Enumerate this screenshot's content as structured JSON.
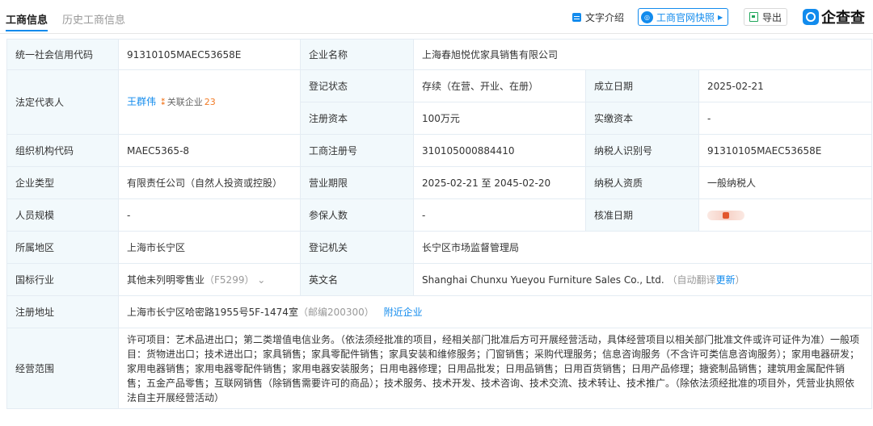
{
  "tabs": [
    {
      "label": "工商信息",
      "active": true
    },
    {
      "label": "历史工商信息",
      "active": false
    }
  ],
  "toolbar": {
    "text_intro_label": "文字介绍",
    "snapshot_label": "工商官网快照",
    "export_label": "导出",
    "logo_text": "企查查"
  },
  "colors": {
    "accent": "#128bed",
    "label_bg": "#f2f9fc",
    "border": "#e4ecf3",
    "badge_orange": "#f27a24"
  },
  "fields": {
    "credit_code": {
      "label": "统一社会信用代码",
      "value": "91310105MAEC53658E"
    },
    "company_name": {
      "label": "企业名称",
      "value": "上海春旭悦优家具销售有限公司"
    },
    "legal_rep": {
      "label": "法定代表人",
      "value": "王群伟",
      "related_label": "关联企业",
      "related_count": "23"
    },
    "reg_status": {
      "label": "登记状态",
      "value": "存续（在营、开业、在册）"
    },
    "established": {
      "label": "成立日期",
      "value": "2025-02-21"
    },
    "reg_capital": {
      "label": "注册资本",
      "value": "100万元"
    },
    "paid_capital": {
      "label": "实缴资本",
      "value": "-"
    },
    "org_code": {
      "label": "组织机构代码",
      "value": "MAEC5365-8"
    },
    "reg_number": {
      "label": "工商注册号",
      "value": "310105000884410"
    },
    "taxpayer_id": {
      "label": "纳税人识别号",
      "value": "91310105MAEC53658E"
    },
    "company_type": {
      "label": "企业类型",
      "value": "有限责任公司（自然人投资或控股）"
    },
    "business_term": {
      "label": "营业期限",
      "value": "2025-02-21 至 2045-02-20"
    },
    "taxpayer_qual": {
      "label": "纳税人资质",
      "value": "一般纳税人"
    },
    "staff_size": {
      "label": "人员规模",
      "value": "-"
    },
    "insured": {
      "label": "参保人数",
      "value": "-"
    },
    "approval_date": {
      "label": "核准日期",
      "value": ""
    },
    "region": {
      "label": "所属地区",
      "value": "上海市长宁区"
    },
    "reg_authority": {
      "label": "登记机关",
      "value": "长宁区市场监督管理局"
    },
    "industry": {
      "label": "国标行业",
      "value": "其他未列明零售业",
      "code": "（F5299）"
    },
    "english_name": {
      "label": "英文名",
      "value": "Shanghai Chunxu Yueyou Furniture Sales Co., Ltd.",
      "note": "（自动翻译",
      "update_link": "更新",
      "note_end": "）"
    },
    "address": {
      "label": "注册地址",
      "value": "上海市长宁区哈密路1955号5F-1474室",
      "postcode": "（邮编200300）",
      "nearby_link": "附近企业"
    },
    "scope": {
      "label": "经营范围",
      "value": "许可项目：艺术品进出口；第二类增值电信业务。（依法须经批准的项目，经相关部门批准后方可开展经营活动，具体经营项目以相关部门批准文件或许可证件为准）一般项目：货物进出口；技术进出口；家具销售；家具零配件销售；家具安装和维修服务；门窗销售；采购代理服务；信息咨询服务（不含许可类信息咨询服务）；家用电器研发；家用电器销售；家用电器零配件销售；家用电器安装服务；日用电器修理；日用品批发；日用品销售；日用百货销售；日用产品修理；搪瓷制品销售；建筑用金属配件销售；五金产品零售；互联网销售（除销售需要许可的商品）；技术服务、技术开发、技术咨询、技术交流、技术转让、技术推广。（除依法须经批准的项目外，凭营业执照依法自主开展经营活动）"
    }
  }
}
